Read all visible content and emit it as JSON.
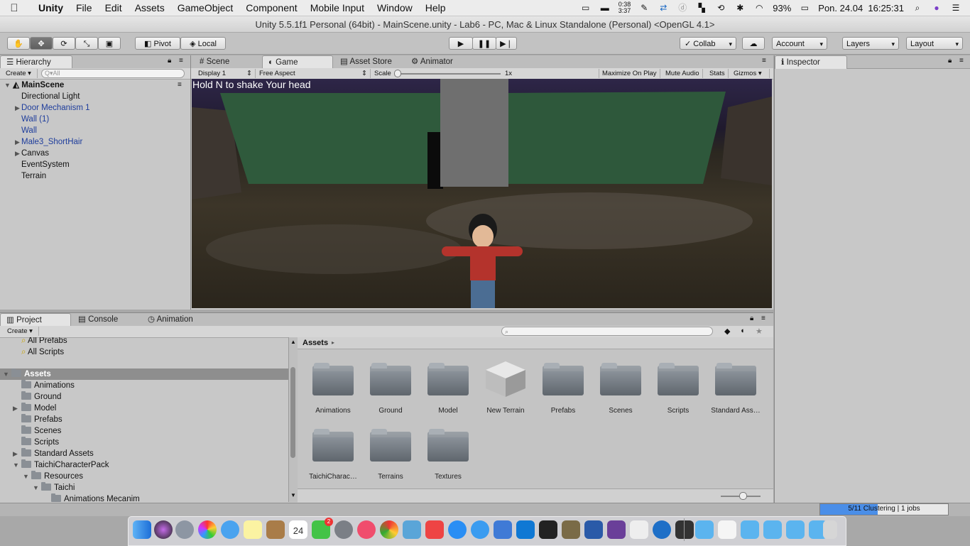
{
  "menubar": {
    "app_name": "Unity",
    "items": [
      "File",
      "Edit",
      "Assets",
      "GameObject",
      "Component",
      "Mobile Input",
      "Window",
      "Help"
    ],
    "clock_top": "0:38",
    "clock_bottom": "3:37",
    "battery": "93%",
    "datetime": "Pon. 24.04  16:25:31"
  },
  "window": {
    "title": "Unity 5.5.1f1 Personal (64bit) - MainScene.unity - Lab6 - PC, Mac & Linux Standalone (Personal) <OpenGL 4.1>"
  },
  "toolbar": {
    "pivot": "Pivot",
    "local": "Local",
    "collab": "Collab",
    "account": "Account",
    "layers": "Layers",
    "layout": "Layout"
  },
  "hierarchy": {
    "tab": "Hierarchy",
    "create": "Create",
    "search_placeholder": "Q▾All",
    "scene": "MainScene",
    "items": [
      {
        "label": "Directional Light",
        "prefab": false,
        "expandable": false
      },
      {
        "label": "Door Mechanism 1",
        "prefab": true,
        "expandable": true
      },
      {
        "label": "Wall (1)",
        "prefab": true,
        "expandable": false
      },
      {
        "label": "Wall",
        "prefab": true,
        "expandable": false
      },
      {
        "label": "Male3_ShortHair",
        "prefab": true,
        "expandable": true
      },
      {
        "label": "Canvas",
        "prefab": false,
        "expandable": true
      },
      {
        "label": "EventSystem",
        "prefab": false,
        "expandable": false
      },
      {
        "label": "Terrain",
        "prefab": false,
        "expandable": false
      }
    ]
  },
  "center_tabs": {
    "scene": "Scene",
    "game": "Game",
    "asset_store": "Asset Store",
    "animator": "Animator"
  },
  "game_bar": {
    "display": "Display 1",
    "aspect": "Free Aspect",
    "scale_label": "Scale",
    "scale_value": "1x",
    "scale_fraction": 0.0,
    "maximize": "Maximize On Play",
    "mute": "Mute Audio",
    "stats": "Stats",
    "gizmos": "Gizmos"
  },
  "game_view": {
    "overlay_text": "Hold N to shake Your head"
  },
  "inspector": {
    "tab": "Inspector"
  },
  "bottom_tabs": {
    "project": "Project",
    "console": "Console",
    "animation": "Animation"
  },
  "project": {
    "create": "Create",
    "favorites": [
      "All Prefabs",
      "All Scripts"
    ],
    "tree": [
      {
        "label": "Assets",
        "depth": 0,
        "expanded": true,
        "selected": true
      },
      {
        "label": "Animations",
        "depth": 1,
        "expanded": false
      },
      {
        "label": "Ground",
        "depth": 1,
        "expanded": false
      },
      {
        "label": "Model",
        "depth": 1,
        "expandable": true
      },
      {
        "label": "Prefabs",
        "depth": 1
      },
      {
        "label": "Scenes",
        "depth": 1
      },
      {
        "label": "Scripts",
        "depth": 1
      },
      {
        "label": "Standard Assets",
        "depth": 1,
        "expandable": true
      },
      {
        "label": "TaichiCharacterPack",
        "depth": 1,
        "expanded": true
      },
      {
        "label": "Resources",
        "depth": 2,
        "expanded": true
      },
      {
        "label": "Taichi",
        "depth": 3,
        "expanded": true
      },
      {
        "label": "Animations Mecanim",
        "depth": 4
      }
    ],
    "breadcrumb": "Assets",
    "assets": [
      {
        "label": "Animations",
        "icon": "folder-icon"
      },
      {
        "label": "Ground",
        "icon": "folder-icon"
      },
      {
        "label": "Model",
        "icon": "folder-icon"
      },
      {
        "label": "New Terrain",
        "icon": "terrain-icon"
      },
      {
        "label": "Prefabs",
        "icon": "folder-icon"
      },
      {
        "label": "Scenes",
        "icon": "folder-icon"
      },
      {
        "label": "Scripts",
        "icon": "folder-icon"
      },
      {
        "label": "Standard Ass…",
        "icon": "folder-icon"
      },
      {
        "label": "TaichiCharac…",
        "icon": "folder-icon"
      },
      {
        "label": "Terrains",
        "icon": "folder-icon"
      },
      {
        "label": "Textures",
        "icon": "folder-icon"
      }
    ]
  },
  "status": {
    "progress_text": "5/11 Clustering | 1 jobs",
    "progress_fraction": 0.45
  },
  "dock": {
    "calendar_day": "24",
    "messages_badge": "2"
  }
}
